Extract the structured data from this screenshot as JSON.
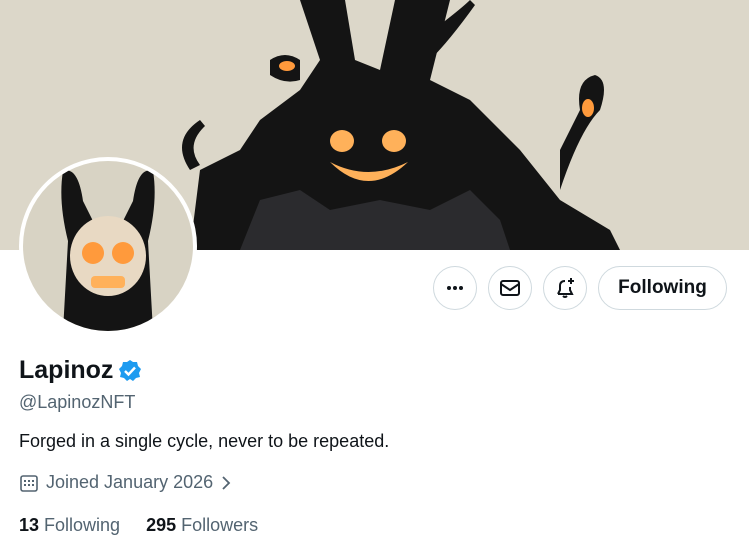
{
  "profile": {
    "display_name": "Lapinoz",
    "handle": "@LapinozNFT",
    "bio": "Forged in a single cycle, never to be repeated.",
    "joined": "Joined January 2026",
    "verified": true
  },
  "stats": {
    "following_count": "13",
    "following_label": "Following",
    "followers_count": "295",
    "followers_label": "Followers"
  },
  "actions": {
    "more_icon": "more-icon",
    "message_icon": "mail-icon",
    "notify_icon": "bell-plus-icon",
    "follow_label": "Following"
  },
  "colors": {
    "banner_bg": "#dcd7c9",
    "verified": "#1d9bf0",
    "glow": "#ff9a3c"
  }
}
